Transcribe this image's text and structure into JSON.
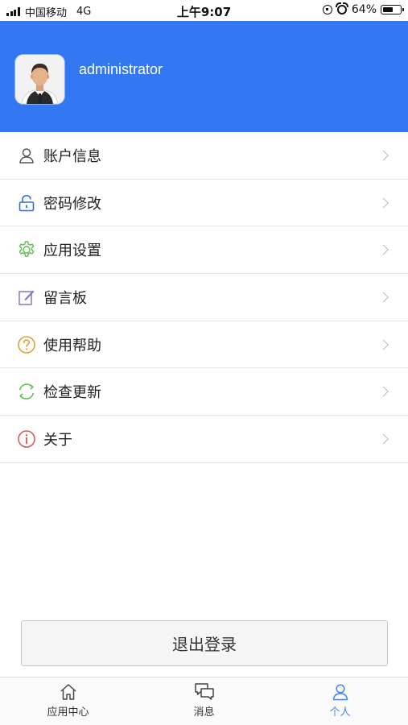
{
  "status_bar": {
    "carrier": "中国移动",
    "network": "4G",
    "time": "上午9:07",
    "battery_percent_text": "64%",
    "battery_level": 0.64
  },
  "header": {
    "username": "administrator",
    "background_color": "#3378f2"
  },
  "menu": {
    "items": [
      {
        "label": "账户信息",
        "icon": "user-icon",
        "icon_color": "#555555"
      },
      {
        "label": "密码修改",
        "icon": "unlock-icon",
        "icon_color": "#2f6fd6"
      },
      {
        "label": "应用设置",
        "icon": "gear-icon",
        "icon_color": "#5cbf4e"
      },
      {
        "label": "留言板",
        "icon": "edit-icon",
        "icon_color": "#8a72c9"
      },
      {
        "label": "使用帮助",
        "icon": "help-icon",
        "icon_color": "#e0a233"
      },
      {
        "label": "检查更新",
        "icon": "refresh-icon",
        "icon_color": "#5cbf4e"
      },
      {
        "label": "关于",
        "icon": "info-icon",
        "icon_color": "#d9534f"
      }
    ]
  },
  "logout": {
    "label": "退出登录"
  },
  "tabbar": {
    "tabs": [
      {
        "label": "应用中心",
        "icon": "home-icon",
        "active": false
      },
      {
        "label": "消息",
        "icon": "chat-icon",
        "active": false
      },
      {
        "label": "个人",
        "icon": "person-icon",
        "active": true
      }
    ],
    "active_color": "#3d87f0"
  }
}
